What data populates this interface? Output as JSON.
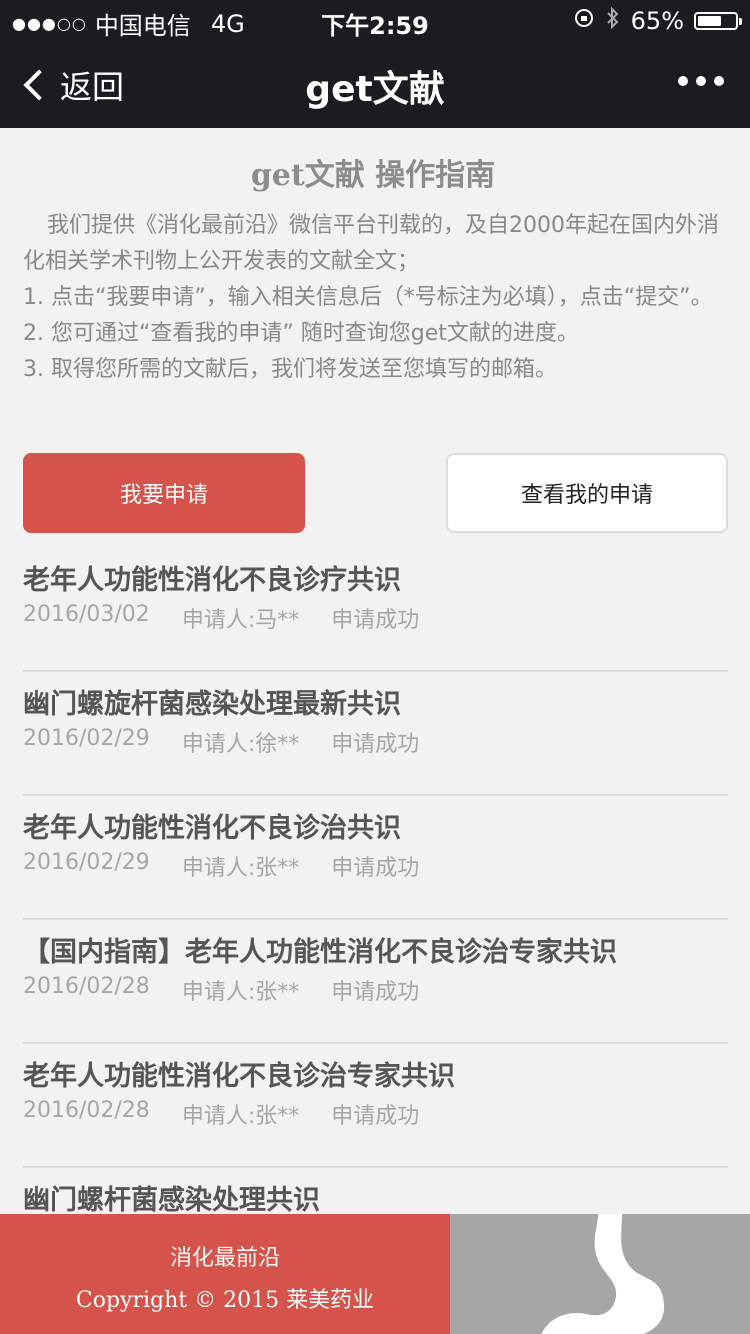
{
  "status_bar": {
    "signal": "●●●○○",
    "carrier": "中国电信",
    "network": "4G",
    "time": "下午2:59",
    "battery_percent": "65%",
    "battery_level": 0.65
  },
  "nav": {
    "back_label": "返回",
    "title": "get文献"
  },
  "guide": {
    "title": "get文献 操作指南",
    "intro": "我们提供《消化最前沿》微信平台刊载的，及自2000年起在国内外消化相关学术刊物上公开发表的文献全文；",
    "steps": [
      "1. 点击“我要申请”，输入相关信息后（*号标注为必填），点击“提交”。",
      "2. 您可通过“查看我的申请” 随时查询您get文献的进度。",
      "3. 取得您所需的文献后，我们将发送至您填写的邮箱。"
    ]
  },
  "buttons": {
    "apply": "我要申请",
    "view": "查看我的申请"
  },
  "records": [
    {
      "title": "老年人功能性消化不良诊疗共识",
      "date": "2016/03/02",
      "applicant": "申请人:马**",
      "status": "申请成功"
    },
    {
      "title": "幽门螺旋杆菌感染处理最新共识",
      "date": "2016/02/29",
      "applicant": "申请人:徐**",
      "status": "申请成功"
    },
    {
      "title": "老年人功能性消化不良诊治共识",
      "date": "2016/02/29",
      "applicant": "申请人:张**",
      "status": "申请成功"
    },
    {
      "title": "【国内指南】老年人功能性消化不良诊治专家共识",
      "date": "2016/02/28",
      "applicant": "申请人:张**",
      "status": "申请成功"
    },
    {
      "title": "老年人功能性消化不良诊治专家共识",
      "date": "2016/02/28",
      "applicant": "申请人:张**",
      "status": "申请成功"
    },
    {
      "title": "幽门螺杆菌感染处理共识",
      "date": "",
      "applicant": "",
      "status": ""
    }
  ],
  "footer": {
    "name": "消化最前沿",
    "copyright": "Copyright © 2015 莱美药业"
  },
  "colors": {
    "accent": "#d5534a",
    "nav_bg": "#1c1c20",
    "page_bg": "#f2f2f2"
  }
}
